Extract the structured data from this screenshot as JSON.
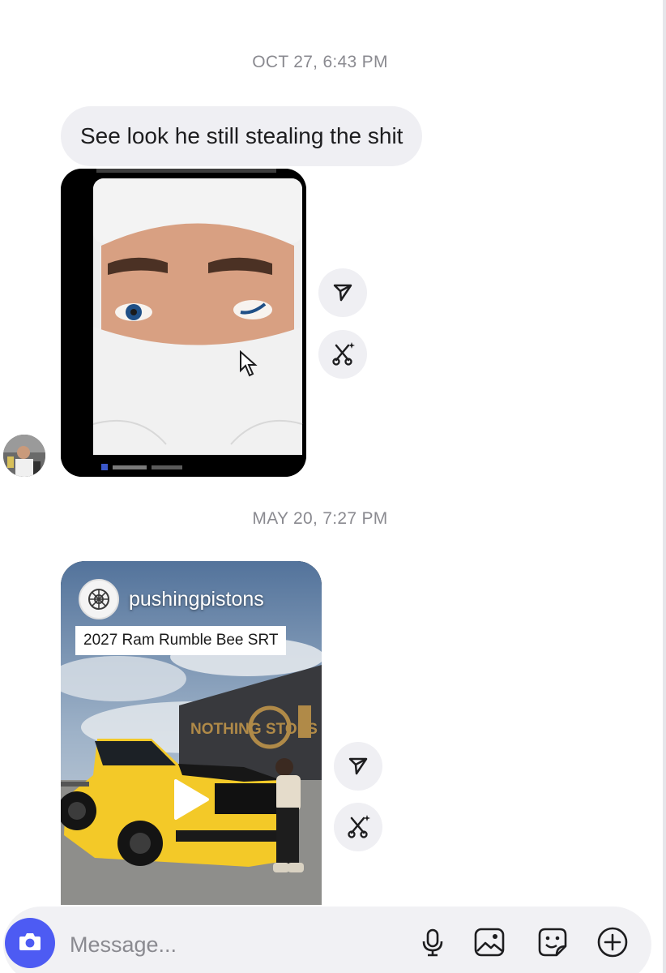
{
  "thread": {
    "timestamp_1": "OCT 27, 6:43 PM",
    "message_1": "See look he still stealing the shit",
    "timestamp_2": "MAY 20, 7:27 PM",
    "shared_post": {
      "account": "pushingpistons",
      "caption": "2027 Ram Rumble Bee SRT",
      "wall_sign": "NOTHING STOPS",
      "media": "video"
    }
  },
  "composer": {
    "placeholder": "Message..."
  },
  "icons": {
    "share": "share-icon",
    "remix": "remix-icon",
    "play": "play-icon",
    "camera": "camera-icon",
    "microphone": "microphone-icon",
    "gallery": "image-icon",
    "sticker": "sticker-icon",
    "add": "plus-icon",
    "cursor": "cursor-icon"
  },
  "colors": {
    "accent": "#4d5bf3",
    "bubble": "#efeff3",
    "timestamp": "#8a8a90",
    "truck_yellow": "#f3c928"
  }
}
